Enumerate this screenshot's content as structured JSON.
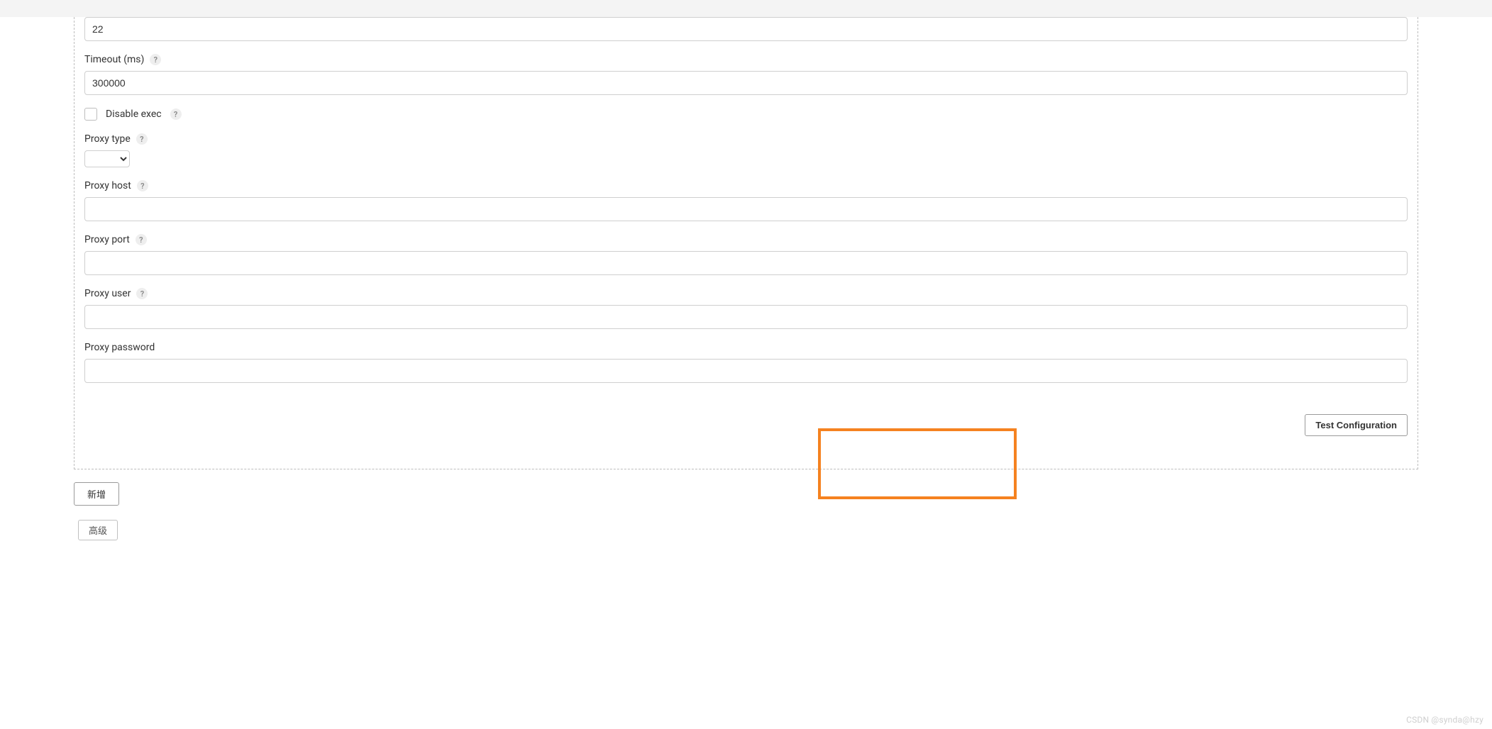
{
  "form": {
    "port": {
      "value": "22"
    },
    "timeout": {
      "label": "Timeout (ms)",
      "value": "300000"
    },
    "disable_exec": {
      "label": "Disable exec",
      "checked": false
    },
    "proxy_type": {
      "label": "Proxy type",
      "value": ""
    },
    "proxy_host": {
      "label": "Proxy host",
      "value": ""
    },
    "proxy_port": {
      "label": "Proxy port",
      "value": ""
    },
    "proxy_user": {
      "label": "Proxy user",
      "value": ""
    },
    "proxy_password": {
      "label": "Proxy password",
      "value": ""
    }
  },
  "buttons": {
    "test_config": "Test Configuration",
    "add": "新增",
    "advanced": "高级"
  },
  "help_glyph": "?",
  "watermark": "CSDN @synda@hzy"
}
